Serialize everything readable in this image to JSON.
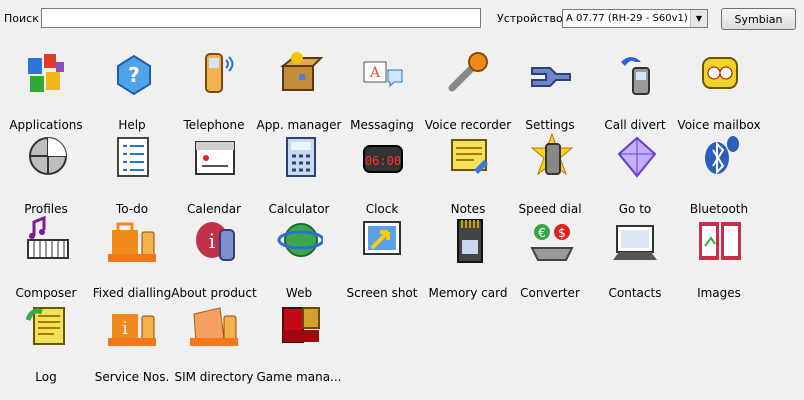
{
  "toolbar": {
    "search_label": "Поиск",
    "search_value": "",
    "device_label": "Устройство",
    "device_selected": "A 07.77 (RH-29 - S60v1)",
    "platform_button": "Symbian"
  },
  "apps": [
    {
      "label": "Applications",
      "icon": "applications-icon"
    },
    {
      "label": "Help",
      "icon": "help-icon"
    },
    {
      "label": "Telephone",
      "icon": "telephone-icon"
    },
    {
      "label": "App. manager",
      "icon": "app-manager-icon"
    },
    {
      "label": "Messaging",
      "icon": "messaging-icon"
    },
    {
      "label": "Voice recorder",
      "icon": "voice-recorder-icon"
    },
    {
      "label": "Settings",
      "icon": "settings-icon"
    },
    {
      "label": "Call divert",
      "icon": "call-divert-icon"
    },
    {
      "label": "Voice mailbox",
      "icon": "voice-mailbox-icon"
    },
    {
      "label": "Profiles",
      "icon": "profiles-icon"
    },
    {
      "label": "To-do",
      "icon": "todo-icon"
    },
    {
      "label": "Calendar",
      "icon": "calendar-icon"
    },
    {
      "label": "Calculator",
      "icon": "calculator-icon"
    },
    {
      "label": "Clock",
      "icon": "clock-icon"
    },
    {
      "label": "Notes",
      "icon": "notes-icon"
    },
    {
      "label": "Speed dial",
      "icon": "speed-dial-icon"
    },
    {
      "label": "Go to",
      "icon": "goto-icon"
    },
    {
      "label": "Bluetooth",
      "icon": "bluetooth-icon"
    },
    {
      "label": "Composer",
      "icon": "composer-icon"
    },
    {
      "label": "Fixed dialling",
      "icon": "fixed-dialling-icon"
    },
    {
      "label": "About product",
      "icon": "about-product-icon"
    },
    {
      "label": "Web",
      "icon": "web-icon"
    },
    {
      "label": "Screen shot",
      "icon": "screen-shot-icon"
    },
    {
      "label": "Memory card",
      "icon": "memory-card-icon"
    },
    {
      "label": "Converter",
      "icon": "converter-icon"
    },
    {
      "label": "Contacts",
      "icon": "contacts-icon"
    },
    {
      "label": "Images",
      "icon": "images-icon"
    },
    {
      "label": "Log",
      "icon": "log-icon"
    },
    {
      "label": "Service Nos.",
      "icon": "service-nos-icon"
    },
    {
      "label": "SIM directory",
      "icon": "sim-directory-icon"
    },
    {
      "label": "Game mana...",
      "icon": "game-manager-icon"
    }
  ]
}
